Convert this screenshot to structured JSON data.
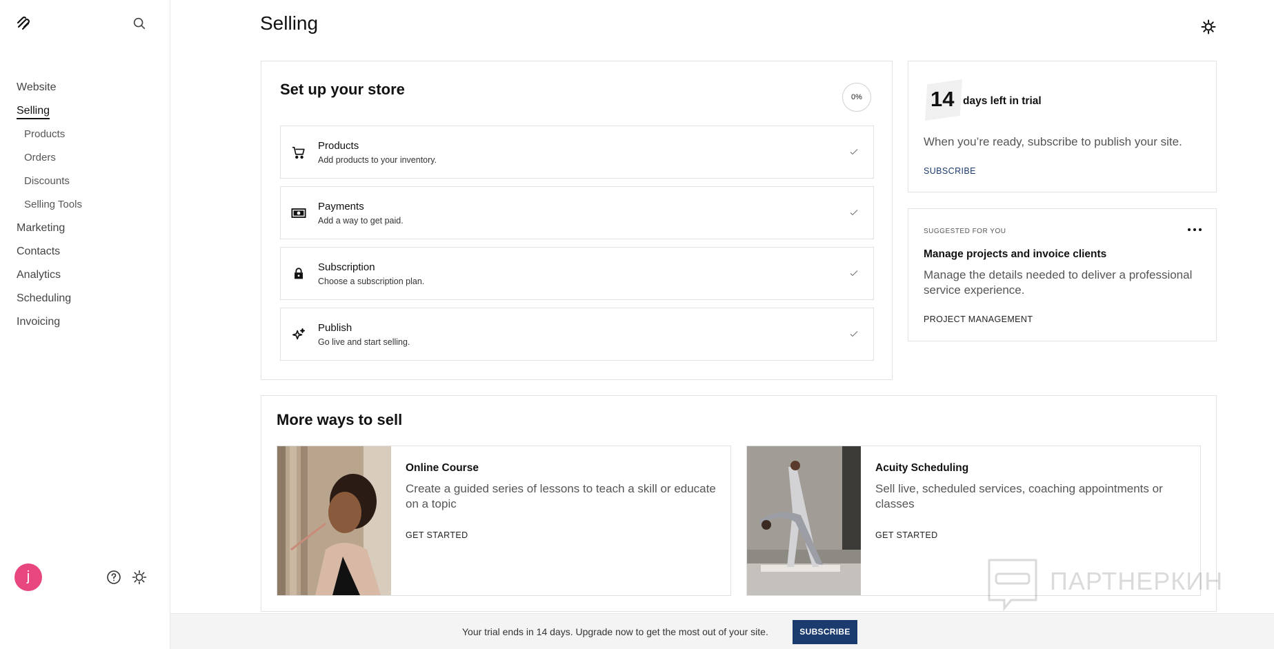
{
  "sidebar": {
    "logo": "squarespace-logo-icon",
    "nav": [
      {
        "label": "Website"
      },
      {
        "label": "Selling",
        "active": true
      },
      {
        "label": "Products",
        "sub": true
      },
      {
        "label": "Orders",
        "sub": true
      },
      {
        "label": "Discounts",
        "sub": true
      },
      {
        "label": "Selling Tools",
        "sub": true
      },
      {
        "label": "Marketing"
      },
      {
        "label": "Contacts"
      },
      {
        "label": "Analytics"
      },
      {
        "label": "Scheduling"
      },
      {
        "label": "Invoicing"
      }
    ],
    "avatar_initial": "j",
    "avatar_color": "#e8467e"
  },
  "header": {
    "title": "Selling"
  },
  "setup": {
    "title": "Set up your store",
    "progress": "0%",
    "steps": [
      {
        "title": "Products",
        "desc": "Add products to your inventory.",
        "icon": "cart-icon"
      },
      {
        "title": "Payments",
        "desc": "Add a way to get paid.",
        "icon": "money-icon"
      },
      {
        "title": "Subscription",
        "desc": "Choose a subscription plan.",
        "icon": "lock-icon"
      },
      {
        "title": "Publish",
        "desc": "Go live and start selling.",
        "icon": "sparkle-icon"
      }
    ]
  },
  "trial": {
    "days": "14",
    "label": "days left in trial",
    "text": "When you’re ready, subscribe to publish your site.",
    "link": "SUBSCRIBE"
  },
  "suggested": {
    "kicker": "SUGGESTED FOR YOU",
    "title": "Manage projects and invoice clients",
    "text": "Manage the details needed to deliver a professional service experience.",
    "link": "PROJECT MANAGEMENT"
  },
  "ways": {
    "title": "More ways to sell",
    "tiles": [
      {
        "title": "Online Course",
        "desc": "Create a guided series of lessons to teach a skill or educate on a topic",
        "link": "GET STARTED"
      },
      {
        "title": "Acuity Scheduling",
        "desc": "Sell live, scheduled services, coaching appointments or classes",
        "link": "GET STARTED"
      }
    ]
  },
  "banner": {
    "text": "Your trial ends in 14 days. Upgrade now to get the most out of your site.",
    "button": "SUBSCRIBE",
    "button_color": "#1b3b6f"
  },
  "watermark": {
    "text": "ПАРТНЕРКИН"
  }
}
